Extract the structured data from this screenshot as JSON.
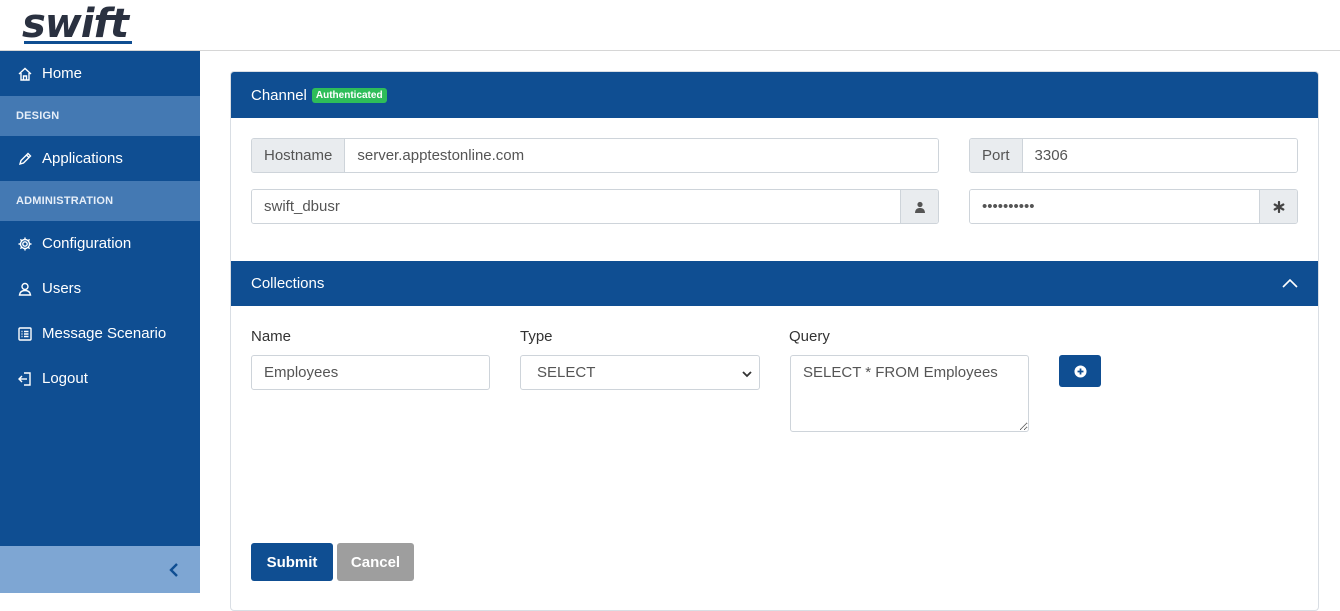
{
  "brand": {
    "logo_text": "swift"
  },
  "sidebar": {
    "home": "Home",
    "section_design": "DESIGN",
    "applications": "Applications",
    "section_administration": "ADMINISTRATION",
    "configuration": "Configuration",
    "users": "Users",
    "message_scenario": "Message Scenario",
    "logout": "Logout"
  },
  "channel": {
    "title": "Channel",
    "badge": "Authenticated",
    "hostname_label": "Hostname",
    "hostname_value": "server.apptestonline.com",
    "port_label": "Port",
    "port_value": "3306",
    "username_value": "swift_dbusr",
    "password_value": "**********"
  },
  "collections": {
    "title": "Collections",
    "name_label": "Name",
    "type_label": "Type",
    "query_label": "Query",
    "name_value": "Employees",
    "type_value": "SELECT",
    "query_value": "SELECT * FROM Employees"
  },
  "actions": {
    "submit": "Submit",
    "cancel": "Cancel"
  },
  "colors": {
    "primary": "#0f4e92",
    "section": "#4479b3",
    "badge": "#2ebd59",
    "cancel": "#9e9e9e"
  }
}
